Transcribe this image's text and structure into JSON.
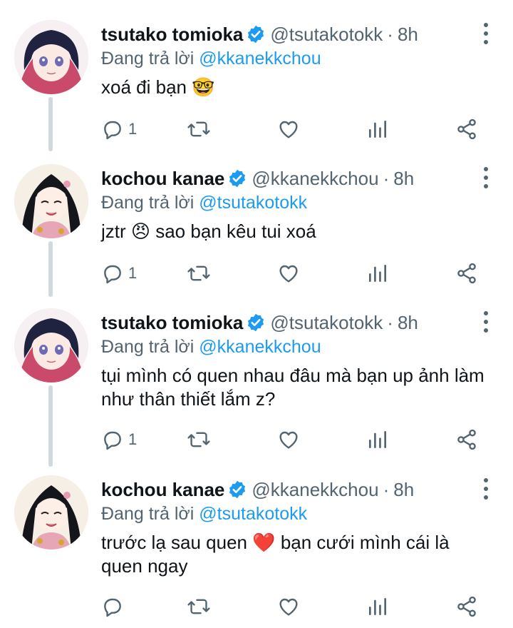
{
  "colors": {
    "accent": "#1d9bf0",
    "secondary_text": "#536471",
    "thread_line": "#cfd9de",
    "primary_text": "#0f1419"
  },
  "tweets": [
    {
      "display_name": "tsutako tomioka",
      "handle": "@tsutakotokk",
      "separator": "·",
      "time": "8h",
      "reply_prefix": "Đang trả lời",
      "reply_to": "@kkanekkchou",
      "text": "xoá đi bạn 🤓",
      "reply_count": "1",
      "avatar": "tsutako-avatar",
      "emoji_icons": [
        "nerd-face"
      ]
    },
    {
      "display_name": "kochou kanae",
      "handle": "@kkanekkchou",
      "separator": "·",
      "time": "8h",
      "reply_prefix": "Đang trả lời",
      "reply_to": "@tsutakotokk",
      "text": "jztr 😠  sao bạn kêu tui xoá",
      "reply_count": "1",
      "avatar": "kanae-avatar",
      "emoji_icons": [
        "angry-face"
      ]
    },
    {
      "display_name": "tsutako tomioka",
      "handle": "@tsutakotokk",
      "separator": "·",
      "time": "8h",
      "reply_prefix": "Đang trả lời",
      "reply_to": "@kkanekkchou",
      "text": "tụi mình có quen nhau đâu mà bạn up ảnh làm như thân thiết lắm z?",
      "reply_count": "1",
      "avatar": "tsutako-avatar",
      "emoji_icons": []
    },
    {
      "display_name": "kochou kanae",
      "handle": "@kkanekkchou",
      "separator": "·",
      "time": "8h",
      "reply_prefix": "Đang trả lời",
      "reply_to": "@tsutakotokk",
      "text": "trước lạ sau quen ❤️ bạn cưới mình cái là quen ngay",
      "reply_count": "",
      "avatar": "kanae-avatar",
      "emoji_icons": [
        "red-heart"
      ]
    }
  ]
}
